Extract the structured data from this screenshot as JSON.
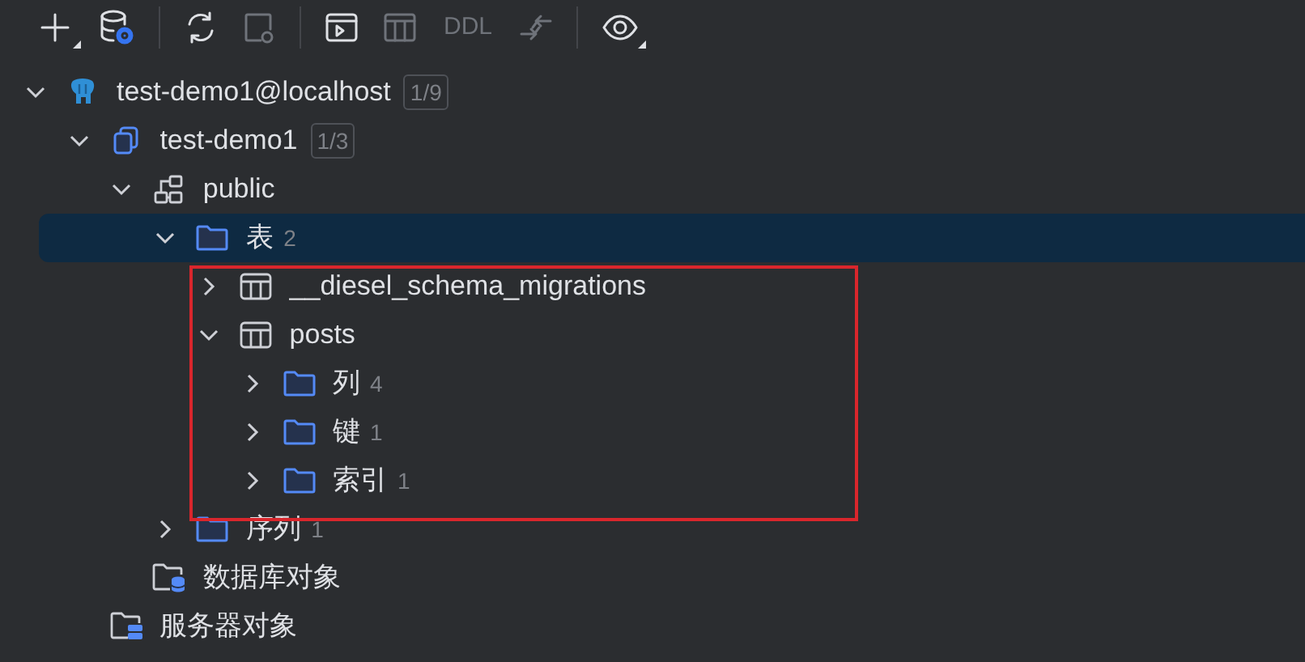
{
  "toolbar": [
    {
      "kind": "add",
      "disabled": false,
      "dropdown": true
    },
    {
      "kind": "db-settings",
      "disabled": false,
      "dropdown": false
    },
    {
      "kind": "separator"
    },
    {
      "kind": "refresh",
      "disabled": false,
      "dropdown": false
    },
    {
      "kind": "jump",
      "disabled": true,
      "dropdown": false
    },
    {
      "kind": "separator"
    },
    {
      "kind": "console",
      "disabled": false,
      "dropdown": false
    },
    {
      "kind": "table",
      "disabled": true,
      "dropdown": false
    },
    {
      "kind": "text",
      "label": "DDL",
      "disabled": true
    },
    {
      "kind": "compare",
      "disabled": true,
      "dropdown": false
    },
    {
      "kind": "separator"
    },
    {
      "kind": "view",
      "disabled": false,
      "dropdown": true
    }
  ],
  "tree": [
    {
      "kind": "server",
      "label": "test-demo1@localhost",
      "badge": "1/9",
      "selected": false,
      "expanded": true,
      "children": [
        {
          "kind": "database",
          "label": "test-demo1",
          "badge": "1/3",
          "selected": false,
          "expanded": true,
          "children": [
            {
              "kind": "schema",
              "label": "public",
              "selected": false,
              "expanded": true,
              "children": [
                {
                  "kind": "folder",
                  "label": "表",
                  "count": "2",
                  "selected": true,
                  "expanded": true,
                  "children": [
                    {
                      "kind": "table",
                      "label": "__diesel_schema_migrations",
                      "selected": false,
                      "expanded": false
                    },
                    {
                      "kind": "table",
                      "label": "posts",
                      "selected": false,
                      "expanded": true,
                      "children": [
                        {
                          "kind": "folder",
                          "label": "列",
                          "count": "4",
                          "selected": false,
                          "expanded": false
                        },
                        {
                          "kind": "folder",
                          "label": "键",
                          "count": "1",
                          "selected": false,
                          "expanded": false
                        },
                        {
                          "kind": "folder",
                          "label": "索引",
                          "count": "1",
                          "selected": false,
                          "expanded": false
                        }
                      ]
                    }
                  ]
                },
                {
                  "kind": "folder",
                  "label": "序列",
                  "count": "1",
                  "selected": false,
                  "expanded": false
                }
              ]
            },
            {
              "kind": "db-objects",
              "label": "数据库对象",
              "selected": false
            }
          ]
        },
        {
          "kind": "server-objects",
          "label": "服务器对象",
          "selected": false
        }
      ]
    }
  ]
}
